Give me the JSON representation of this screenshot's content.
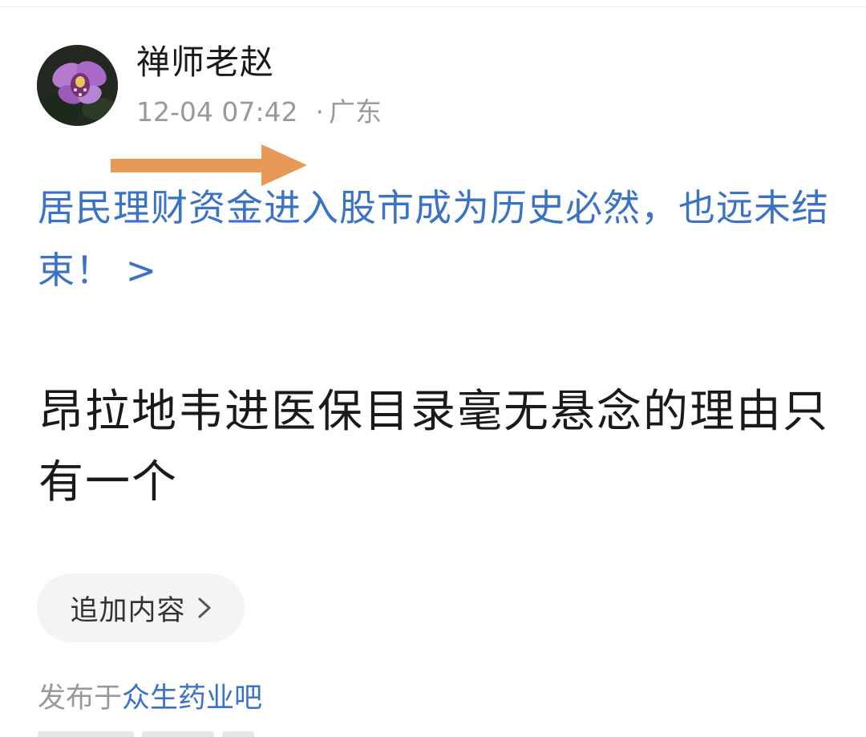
{
  "author": {
    "name": "禅师老赵",
    "avatar": "orchid-avatar-image"
  },
  "meta": {
    "timestamp": "12-04 07:42",
    "separator": "·",
    "location": "广东"
  },
  "annotation": {
    "icon": "orange-arrow-icon",
    "color": "#e79a57"
  },
  "linked_article": {
    "title": "居民理财资金进入股市成为历史必然，也远未结束！ >",
    "color": "#3a72c6"
  },
  "post": {
    "title": "昂拉地韦进医保目录毫无悬念的理由只有一个"
  },
  "actions": {
    "add_content_label": "追加内容",
    "add_content_icon": "chevron-right-icon"
  },
  "published": {
    "prefix": "发布于",
    "forum": "众生药业吧"
  }
}
